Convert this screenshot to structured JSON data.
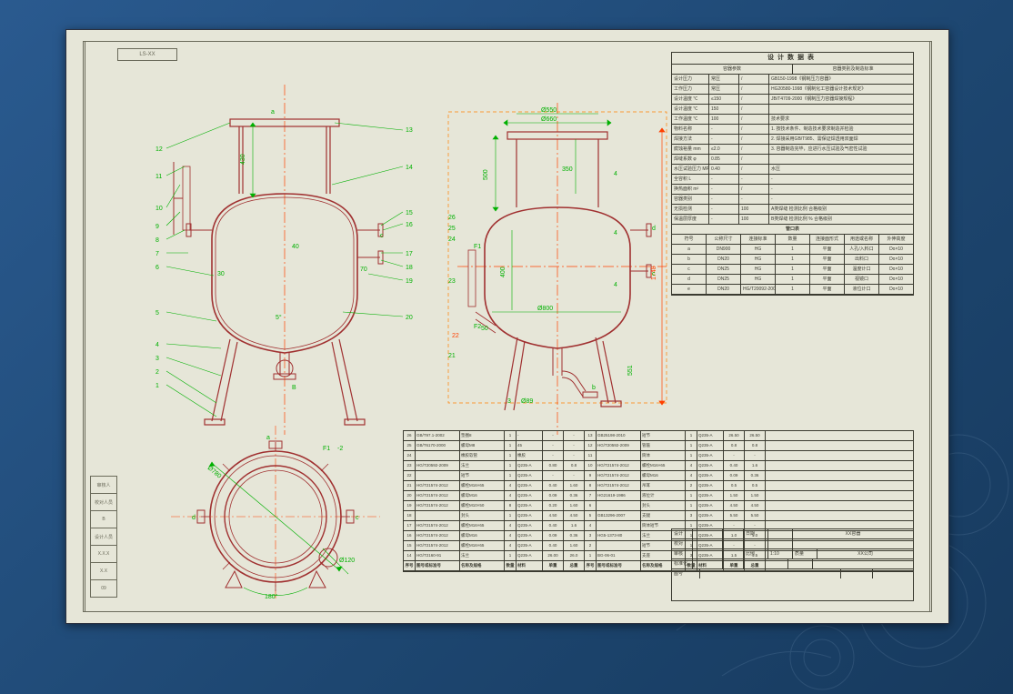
{
  "stamp": "LS-XX",
  "design_table": {
    "title": "设计数据表",
    "header": {
      "left": "容器参数",
      "right": "容器类别及制造标准"
    },
    "rows": [
      {
        "k": "设计压力",
        "v1": "常压",
        "v2": "/",
        "n": "GB150-1998《钢制压力容器》"
      },
      {
        "k": "工作压力",
        "v1": "常压",
        "v2": "/",
        "n": "HG20580-1998《钢制化工容器设计技术规定》"
      },
      {
        "k": "设计温度 ℃",
        "v1": "≤150",
        "v2": "/",
        "n": "JB/T4709-2000《钢制压力容器焊接规程》"
      },
      {
        "k": "设计温度 ℃",
        "v1": "150",
        "v2": "/",
        "n": ""
      },
      {
        "k": "工作温度 ℃",
        "v1": "100",
        "v2": "/",
        "n": "技术要求"
      },
      {
        "k": "物料名称",
        "v1": "-",
        "v2": "/",
        "n": "1. 按技术条件、制造技术要求制造并检验"
      },
      {
        "k": "焊接方法",
        "v1": "-",
        "v2": "/",
        "n": "2. 焊接采用GB/T985、需保证焊透用双面焊"
      },
      {
        "k": "腐蚀裕量 mm",
        "v1": "≤2.0",
        "v2": "/",
        "n": "3. 容器制造完毕，应进行水压试验及气密性试验"
      },
      {
        "k": "焊缝系数 φ",
        "v1": "0.85",
        "v2": "/",
        "n": ""
      },
      {
        "k": "水压试验压力 MPa",
        "v1": "0.40",
        "v2": "/",
        "n": "水压"
      },
      {
        "k": "全容积 L",
        "v1": "-",
        "v2": "-",
        "n": "-"
      },
      {
        "k": "换热面积 m²",
        "v1": "-",
        "v2": "/",
        "n": "-"
      },
      {
        "k": "容器类别",
        "v1": "-",
        "v2": "-",
        "n": "-"
      },
      {
        "k": "无损检测",
        "v1": "-",
        "v2": "100",
        "n": "A类焊缝  检测比例  合格级别"
      },
      {
        "k": "保温层厚度",
        "v1": "-",
        "v2": "100",
        "n": "B类焊缝  检测比例 %  合格级别"
      }
    ],
    "nozzle_title": "管口表",
    "nozzle_header": [
      "符号",
      "公称尺寸",
      "连接标准",
      "数量",
      "连接面形式",
      "用途或名称",
      "外伸高度"
    ],
    "nozzles": [
      {
        "s": "a",
        "dn": "DN900",
        "std": "HG",
        "q": "1",
        "f": "平面",
        "u": "人孔/入料口",
        "h": "Do×10"
      },
      {
        "s": "b",
        "dn": "DN20",
        "std": "HG",
        "q": "1",
        "f": "平面",
        "u": "出料口",
        "h": "Do×10"
      },
      {
        "s": "c",
        "dn": "DN25",
        "std": "HG",
        "q": "1",
        "f": "平面",
        "u": "温度计口",
        "h": "Do×10"
      },
      {
        "s": "d",
        "dn": "DN25",
        "std": "HG",
        "q": "1",
        "f": "平面",
        "u": "视镜口",
        "h": "Do×10"
      },
      {
        "s": "e",
        "dn": "DN20",
        "std": "HG/T20092-2000 HG/T4-95",
        "q": "1",
        "f": "平面",
        "u": "液位计口",
        "h": "Do×10"
      }
    ]
  },
  "bom": {
    "header": [
      "序号",
      "图号或标准号",
      "名称及规格",
      "数量",
      "材料",
      "单重",
      "总重",
      "备注"
    ],
    "rows": [
      {
        "n": "26",
        "c": "GB/T97.1-2002",
        "d": "垫圈8",
        "q": "1",
        "m": "-",
        "w1": "-",
        "w2": "-"
      },
      {
        "n": "25",
        "c": "GB/T6170-2000",
        "d": "螺母M8",
        "q": "1",
        "m": "45",
        "w1": "-",
        "w2": "-"
      },
      {
        "n": "24",
        "c": "",
        "d": "橡胶软管",
        "q": "1",
        "m": "橡胶",
        "w1": "-",
        "w2": "-"
      },
      {
        "n": "23",
        "c": "HG/T20592-2009",
        "d": "法兰",
        "q": "1",
        "m": "Q235-A",
        "w1": "0.80",
        "w2": "0.8"
      },
      {
        "n": "22",
        "c": "",
        "d": "短节",
        "q": "1",
        "m": "Q235-A",
        "w1": "-",
        "w2": "-"
      },
      {
        "n": "21",
        "c": "HG/T21574-2012",
        "d": "螺栓M16×65",
        "q": "4",
        "m": "Q235-A",
        "w1": "0.40",
        "w2": "1.60"
      },
      {
        "n": "20",
        "c": "HG/T21574-2012",
        "d": "螺母M16",
        "q": "4",
        "m": "Q235-A",
        "w1": "0.09",
        "w2": "0.36"
      },
      {
        "n": "19",
        "c": "HG/T21574-2012",
        "d": "螺栓M10×50",
        "q": "8",
        "m": "Q235-A",
        "w1": "0.20",
        "w2": "1.60"
      },
      {
        "n": "18",
        "c": "",
        "d": "封头",
        "q": "1",
        "m": "Q235-A",
        "w1": "4.50",
        "w2": "4.50"
      },
      {
        "n": "17",
        "c": "HG/T21574-2012",
        "d": "螺栓M16×65",
        "q": "4",
        "m": "Q235-A",
        "w1": "0.40",
        "w2": "1.6"
      },
      {
        "n": "16",
        "c": "HG/T21574-2012",
        "d": "螺母M16",
        "q": "4",
        "m": "Q235-A",
        "w1": "0.09",
        "w2": "0.36"
      },
      {
        "n": "15",
        "c": "HG/T21574-2012",
        "d": "螺栓M16×65",
        "q": "4",
        "m": "Q235-A",
        "w1": "0.40",
        "w2": "1.60"
      },
      {
        "n": "14",
        "c": "HG/T2160-91",
        "d": "法兰",
        "q": "1",
        "m": "Q235-A",
        "w1": "26.00",
        "w2": "26.0"
      },
      {
        "n": "13",
        "c": "GB25198-2010",
        "d": "短节",
        "q": "1",
        "m": "Q235-A",
        "w1": "26.50",
        "w2": "26.50"
      },
      {
        "n": "12",
        "c": "HG/T20592-2009",
        "d": "管箍",
        "q": "1",
        "m": "Q235-A",
        "w1": "0.8",
        "w2": "0.8"
      },
      {
        "n": "11",
        "c": "",
        "d": "筒体",
        "q": "1",
        "m": "Q235-A",
        "w1": "-",
        "w2": "-"
      },
      {
        "n": "10",
        "c": "HG/T21574-2012",
        "d": "螺栓M16×65",
        "q": "4",
        "m": "Q235-A",
        "w1": "0.40",
        "w2": "1.6"
      },
      {
        "n": "9",
        "c": "HG/T21574-2012",
        "d": "螺母M16",
        "q": "4",
        "m": "Q235-A",
        "w1": "0.09",
        "w2": "0.36"
      },
      {
        "n": "8",
        "c": "HG/T21574-2012",
        "d": "吊耳",
        "q": "2",
        "m": "Q235-A",
        "w1": "0.5",
        "w2": "0.5"
      },
      {
        "n": "7",
        "c": "HG21619-1986",
        "d": "液位计",
        "q": "1",
        "m": "Q235-A",
        "w1": "1.50",
        "w2": "1.50"
      },
      {
        "n": "6",
        "c": "",
        "d": "封头",
        "q": "1",
        "m": "Q235-A",
        "w1": "4.50",
        "w2": "4.50"
      },
      {
        "n": "5",
        "c": "GB13296-2007",
        "d": "支腿",
        "q": "3",
        "m": "Q235-A",
        "w1": "5.50",
        "w2": "5.50"
      },
      {
        "n": "4",
        "c": "",
        "d": "筒体短节",
        "q": "1",
        "m": "Q235-A",
        "w1": "-",
        "w2": "-"
      },
      {
        "n": "3",
        "c": "HG5-1373-80",
        "d": "法兰",
        "q": "1",
        "m": "Q235-A",
        "w1": "1.0",
        "w2": "1.0"
      },
      {
        "n": "2",
        "c": "",
        "d": "短节",
        "q": "1",
        "m": "Q235-A",
        "w1": "-",
        "w2": "-"
      },
      {
        "n": "1",
        "c": "BG-06-01",
        "d": "支座",
        "q": "3",
        "m": "Q235-A",
        "w1": "1.5",
        "w2": "4.5"
      }
    ]
  },
  "titleblock": {
    "project": "XX容器",
    "drawn": "设计",
    "check": "校对",
    "appr": "审核",
    "std": "标准化",
    "date": "日期",
    "dwg": "图号",
    "scale": "比例",
    "sheet": "1:10",
    "mass": "质量",
    "co": "XX公司"
  },
  "views": {
    "front": {
      "labels": [
        "1",
        "2",
        "3",
        "4",
        "5",
        "6",
        "7",
        "8",
        "9",
        "10",
        "11",
        "12",
        "13",
        "14",
        "15",
        "16",
        "17",
        "18",
        "19",
        "20",
        "a",
        "b",
        "c",
        "d",
        "B"
      ],
      "dims": [
        "430",
        "30",
        "70",
        "40",
        "5°"
      ]
    },
    "side": {
      "labels": [
        "21",
        "22",
        "23",
        "24",
        "25",
        "26",
        "3",
        "F1",
        "F2",
        "b",
        "c",
        "d"
      ],
      "dims": [
        "Ø660",
        "Ø550",
        "500",
        "350",
        "400",
        "50",
        "Ø800",
        "551",
        "Ø89",
        "4",
        "4",
        "4",
        "1748"
      ]
    },
    "top": {
      "labels": [
        "a",
        "b",
        "c",
        "d",
        "F1",
        "-2"
      ],
      "dims": [
        "Ø780",
        "Ø120",
        "180°"
      ]
    }
  },
  "leftcol": [
    "审核人",
    "校对人员",
    "B",
    "设计人员",
    "X.X.X",
    "X.X",
    "09"
  ]
}
